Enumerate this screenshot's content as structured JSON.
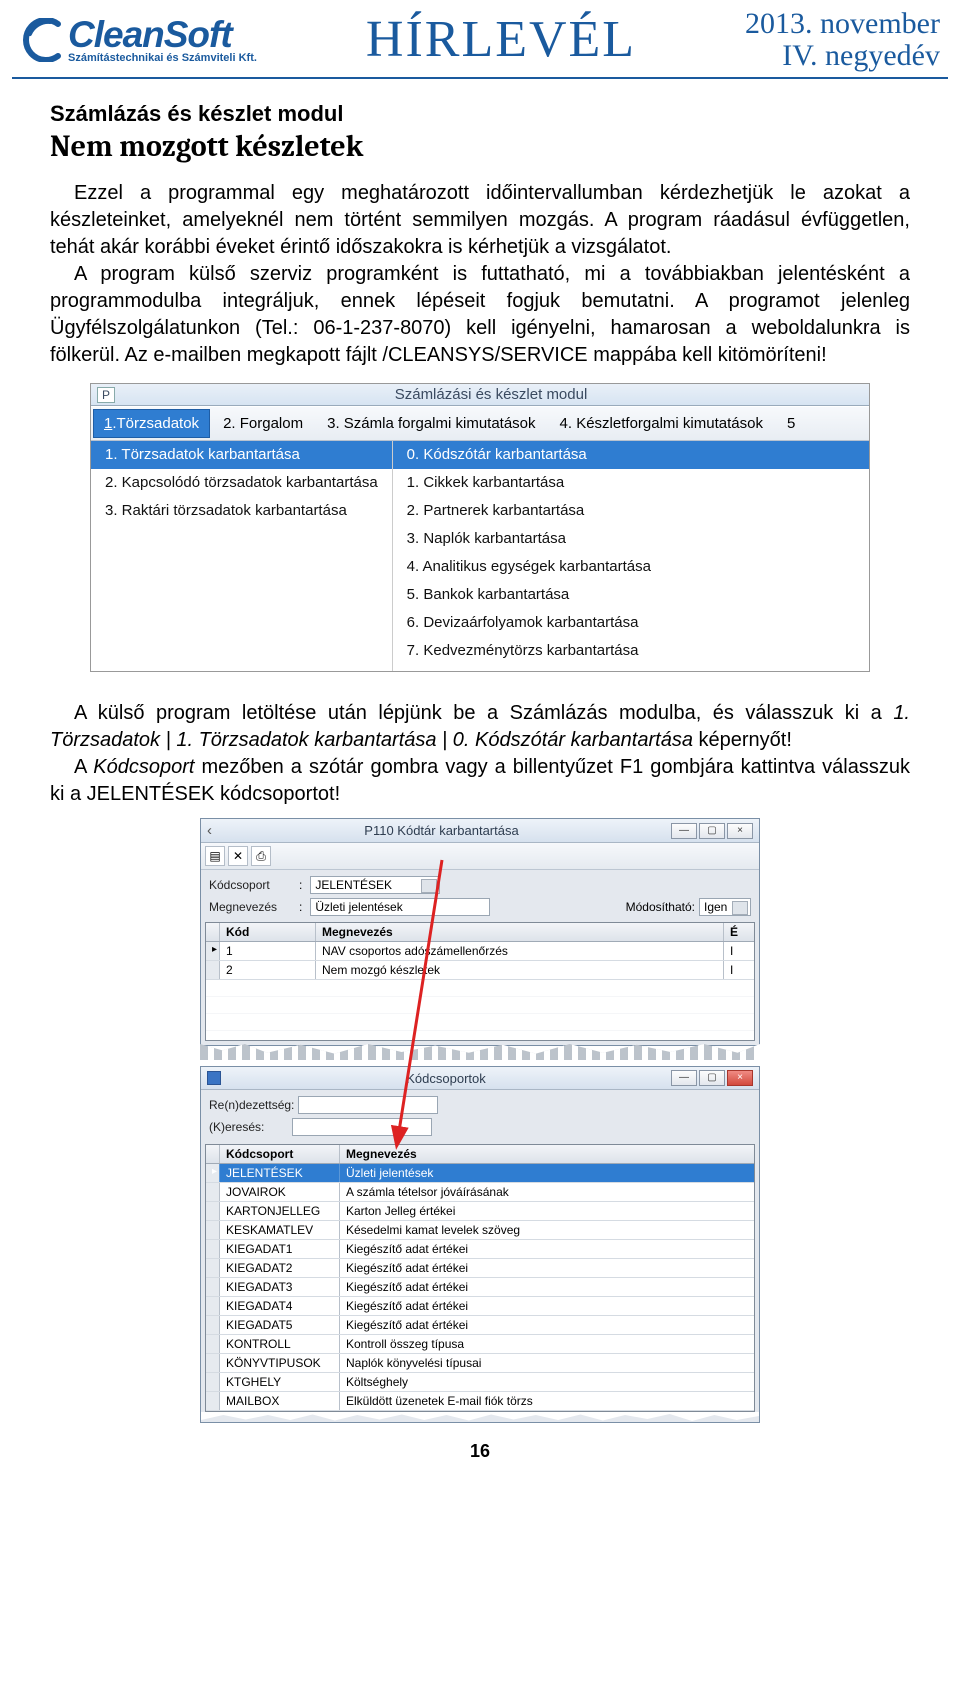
{
  "header": {
    "logo_name": "CleanSoft",
    "logo_sub": "Számítástechnikai és Számviteli Kft.",
    "title": "HÍRLEVÉL",
    "date_line1": "2013. november",
    "date_line2": "IV. negyedév"
  },
  "article": {
    "section_label": "Számlázás és készlet modul",
    "title": "Nem mozgott készletek",
    "para1": "Ezzel a programmal egy meghatározott időintervallumban kérdezhetjük le azokat a készleteinket, amelyeknél nem történt semmilyen mozgás. A program ráadásul évfüggetlen, tehát akár korábbi éveket érintő időszakokra is kérhetjük a vizsgálatot.",
    "para2": "A program külső szerviz programként is futtatható, mi a továbbiakban jelentésként a programmodulba integráljuk, ennek lépéseit fogjuk bemutatni. A programot jelenleg Ügyfélszolgálatunkon (Tel.: 06-1-237-8070) kell igényelni, hamarosan a weboldalunkra is fölkerül. Az e-mailben megkapott fájlt /CLEANSYS/SERVICE mappába kell kitömöríteni!",
    "para3_a": "A külső program letöltése után lépjünk be a Számlázás modulba, és válasszuk ki a ",
    "para3_b": "1. Törzsadatok | 1. Törzsadatok karbantartása | 0. Kódszótár karbantartása",
    "para3_c": " képernyőt!",
    "para4_a": "A ",
    "para4_b": "Kódcsoport",
    "para4_c": " mezőben a szótár gombra vagy a billentyűzet F1 gombjára kattintva válasszuk ki a JELENTÉSEK kódcsoportot!"
  },
  "screenshot1": {
    "p_badge": "P",
    "win_title": "Számlázási és készlet modul",
    "tabs": [
      "1.Törzsadatok",
      "2. Forgalom",
      "3. Számla forgalmi kimutatások",
      "4. Készletforgalmi kimutatások",
      "5"
    ],
    "left_menu": [
      "1. Törzsadatok karbantartása",
      "2. Kapcsolódó törzsadatok karbantartása",
      "3. Raktári törzsadatok karbantartása"
    ],
    "right_menu": [
      "0. Kódszótár karbantartása",
      "1. Cikkek karbantartása",
      "2. Partnerek karbantartása",
      "3. Naplók karbantartása",
      "4. Analitikus egységek karbantartása",
      "5. Bankok karbantartása",
      "6. Devizaárfolyamok karbantartása",
      "7. Kedvezménytörzs karbantartása"
    ]
  },
  "screenshot2": {
    "title": "P110 Kódtár karbantartása",
    "lbl_kodcsoport": "Kódcsoport",
    "val_kodcsoport": "JELENTÉSEK",
    "lbl_megnevezes": "Megnevezés",
    "val_megnevezes": "Üzleti jelentések",
    "lbl_modosithato": "Módosítható:",
    "val_modosithato": "Igen",
    "th_kod": "Kód",
    "th_meg": "Megnevezés",
    "th_e": "É",
    "rows": [
      {
        "kod": "1",
        "meg": "NAV csoportos adószámellenőrzés",
        "e": "I"
      },
      {
        "kod": "2",
        "meg": "Nem mozgó készletek",
        "e": "I"
      }
    ]
  },
  "screenshot3": {
    "title": "Kódcsoportok",
    "lbl_rendezettseg": "Re(n)dezettség:",
    "lbl_kereses": "(K)eresés:",
    "th_kod": "Kódcsoport",
    "th_meg": "Megnevezés",
    "rows": [
      {
        "k": "JELENTÉSEK",
        "m": "Üzleti jelentések",
        "sel": true
      },
      {
        "k": "JOVAIROK",
        "m": "A számla tételsor jóváírásának"
      },
      {
        "k": "KARTONJELLEG",
        "m": "Karton Jelleg értékei"
      },
      {
        "k": "KESKAMATLEV",
        "m": "Késedelmi kamat levelek szöveg"
      },
      {
        "k": "KIEGADAT1",
        "m": "Kiegészítő adat értékei"
      },
      {
        "k": "KIEGADAT2",
        "m": "Kiegészítő adat értékei"
      },
      {
        "k": "KIEGADAT3",
        "m": "Kiegészítő adat értékei"
      },
      {
        "k": "KIEGADAT4",
        "m": "Kiegészítő adat értékei"
      },
      {
        "k": "KIEGADAT5",
        "m": "Kiegészítő adat értékei"
      },
      {
        "k": "KONTROLL",
        "m": "Kontroll összeg típusa"
      },
      {
        "k": "KÖNYVTIPUSOK",
        "m": "Naplók könyvelési típusai"
      },
      {
        "k": "KTGHELY",
        "m": "Költséghely"
      },
      {
        "k": "MAILBOX",
        "m": "Elküldött üzenetek E-mail fiók törzs"
      }
    ]
  },
  "pagenum": "16"
}
